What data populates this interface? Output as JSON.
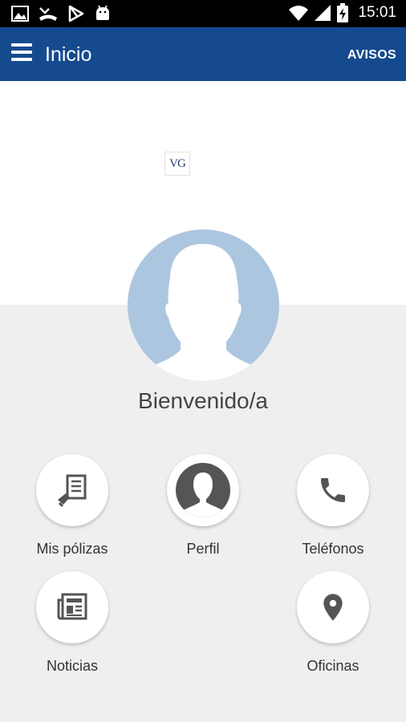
{
  "status_bar": {
    "time": "15:01",
    "icons": [
      "image-icon",
      "missed-call-icon",
      "play-store-icon",
      "android-icon",
      "wifi-icon",
      "signal-icon",
      "battery-charging-icon"
    ]
  },
  "app_bar": {
    "title": "Inicio",
    "action_label": "AVISOS"
  },
  "logo": {
    "text": "VG"
  },
  "welcome_text": "Bienvenido/a",
  "menu": {
    "mis_polizas": {
      "label": "Mis pólizas",
      "icon": "document-icon"
    },
    "perfil": {
      "label": "Perfil",
      "icon": "person-icon"
    },
    "telefonos": {
      "label": "Teléfonos",
      "icon": "phone-icon"
    },
    "noticias": {
      "label": "Noticias",
      "icon": "newspaper-icon"
    },
    "oficinas": {
      "label": "Oficinas",
      "icon": "location-pin-icon"
    }
  },
  "colors": {
    "app_bar": "#154a8f",
    "background": "#efefef",
    "avatar": "#adc6e0",
    "icon": "#555555"
  }
}
